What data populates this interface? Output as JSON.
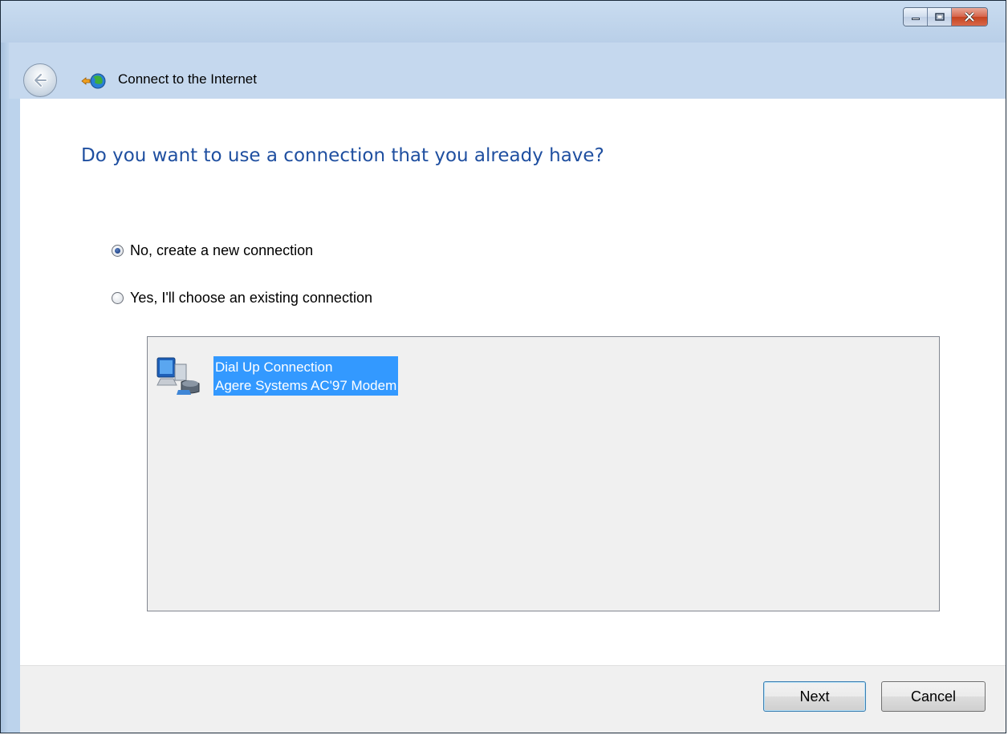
{
  "window": {
    "title": "Connect to the Internet",
    "caption_buttons": [
      "minimize-icon",
      "maximize-icon",
      "close-icon"
    ]
  },
  "heading": "Do you want to use a connection that you already have?",
  "options": [
    {
      "label": "No, create a new connection",
      "selected": true
    },
    {
      "label": "Yes, I'll choose an existing connection",
      "selected": false
    }
  ],
  "connections": [
    {
      "name": "Dial Up Connection",
      "device": "Agere Systems AC'97 Modem",
      "icon": "dialup-connection-icon",
      "selected": true
    }
  ],
  "buttons": {
    "next": "Next",
    "cancel": "Cancel"
  },
  "colors": {
    "heading": "#1f4fa0",
    "selection": "#3399ff",
    "frame": "#bcd3ec"
  }
}
